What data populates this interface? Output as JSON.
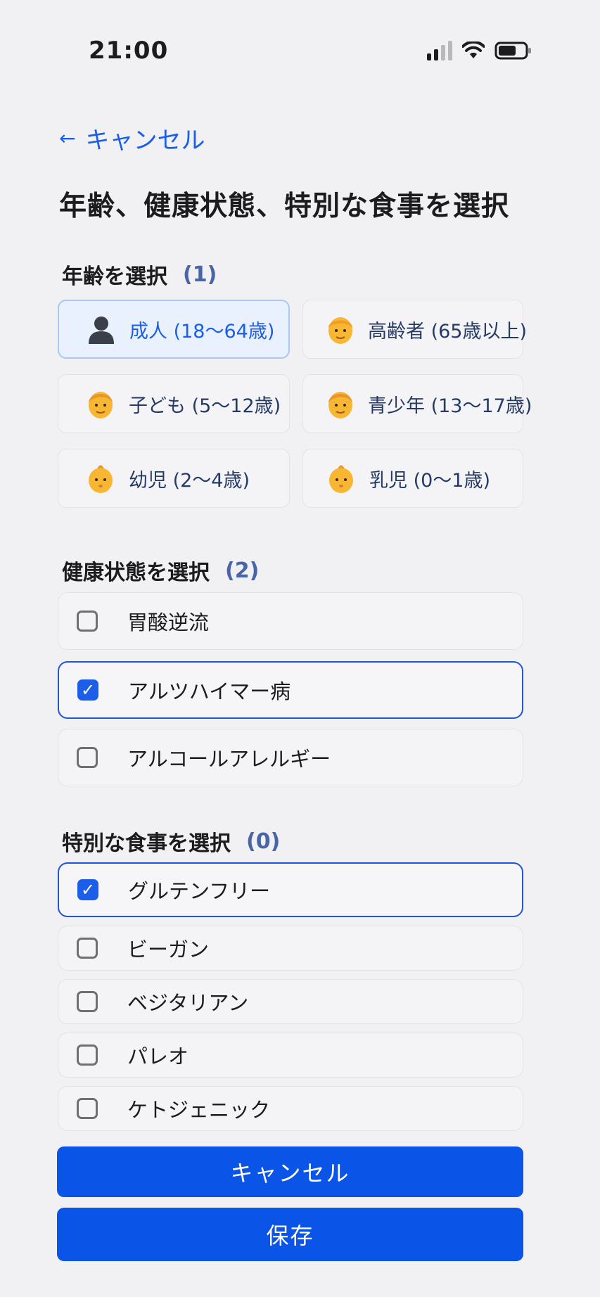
{
  "status_bar": {
    "time": "21:00"
  },
  "nav": {
    "back_label": "キャンセル",
    "back_icon": "left-arrow-icon"
  },
  "title": "年齢、健康状態、特別な食事を選択",
  "age_section": {
    "title": "年齢を選択",
    "count": "(1)",
    "options": [
      {
        "label": "成人 (18〜64歳)",
        "icon": "adult-silhouette-icon",
        "selected": true
      },
      {
        "label": "高齢者 (65歳以上)",
        "icon": "senior-face-icon",
        "selected": false
      },
      {
        "label": "子ども (5〜12歳)",
        "icon": "child-face-icon",
        "selected": false
      },
      {
        "label": "青少年 (13〜17歳)",
        "icon": "teen-face-icon",
        "selected": false
      },
      {
        "label": "幼児 (2〜4歳)",
        "icon": "toddler-face-icon",
        "selected": false
      },
      {
        "label": "乳児 (0〜1歳)",
        "icon": "baby-face-icon",
        "selected": false
      }
    ]
  },
  "health_section": {
    "title": "健康状態を選択",
    "count": "(2)",
    "items": [
      {
        "label": "胃酸逆流",
        "checked": false
      },
      {
        "label": "アルツハイマー病",
        "checked": true
      },
      {
        "label": "アルコールアレルギー",
        "checked": false
      }
    ]
  },
  "diet_section": {
    "title": "特別な食事を選択",
    "count": "(0)",
    "items": [
      {
        "label": "グルテンフリー",
        "checked": true
      },
      {
        "label": "ビーガン",
        "checked": false
      },
      {
        "label": "ベジタリアン",
        "checked": false
      },
      {
        "label": "パレオ",
        "checked": false
      },
      {
        "label": "ケトジェニック",
        "checked": false
      }
    ]
  },
  "buttons": {
    "cancel_label": "キャンセル",
    "save_label": "保存"
  },
  "colors": {
    "accent": "#1b5ee8",
    "button": "#0a54e8",
    "background": "#f1f1f3"
  }
}
